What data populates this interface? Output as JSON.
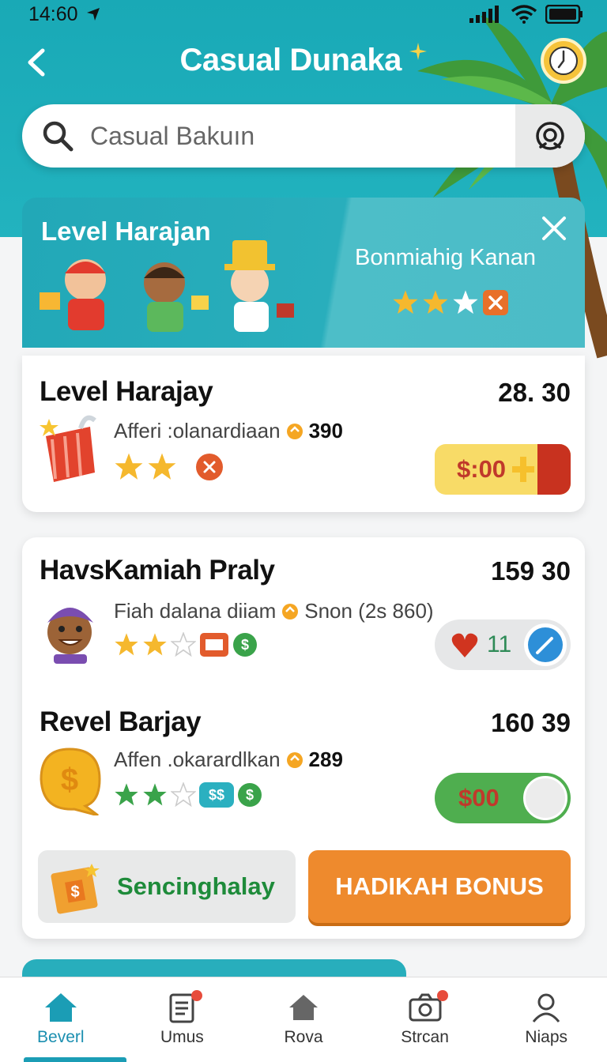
{
  "status_bar": {
    "time": "14:60"
  },
  "header": {
    "title": "Casual Dunaka",
    "back_icon": "chevron-left-icon",
    "clock_icon": "clock-icon"
  },
  "search": {
    "placeholder": "Casual Bakuın",
    "value": ""
  },
  "banner": {
    "title": "Level Harajan",
    "subtitle": "Bonmiahig Kanan",
    "rating": {
      "filled": 2,
      "empty": 1
    }
  },
  "rows": [
    {
      "title": "Level Harajay",
      "value": "28. 30",
      "desc": "Afferi :olanardiaan",
      "desc_amount": "390",
      "rating": {
        "filled": 2,
        "empty": 0
      },
      "action": "$:00"
    },
    {
      "title": "HavsKamiah Praly",
      "value": "159 30",
      "desc": "Fiah dalana diiam",
      "desc_amount": "Snon (2s 860)",
      "rating": {
        "filled": 2,
        "empty": 1
      },
      "action": "11"
    },
    {
      "title": "Revel Barjay",
      "value": "160 39",
      "desc": "Affen .okarardlkan",
      "desc_amount": "289",
      "rating": {
        "filled": 2,
        "empty": 1
      },
      "badge": "$$",
      "action": "$00"
    }
  ],
  "buttons": {
    "secondary": "Sencinghalay",
    "primary": "HADIKAH BONUS"
  },
  "nav": [
    {
      "label": "Beverl",
      "icon": "home-icon",
      "active": true
    },
    {
      "label": "Umus",
      "icon": "clipboard-icon"
    },
    {
      "label": "Rova",
      "icon": "house-icon"
    },
    {
      "label": "Strcan",
      "icon": "camera-icon"
    },
    {
      "label": "Niaps",
      "icon": "user-icon"
    }
  ],
  "colors": {
    "teal": "#22b3bf",
    "orange": "#ee8a2d",
    "green": "#4fae4f",
    "yellow": "#f8db67"
  }
}
